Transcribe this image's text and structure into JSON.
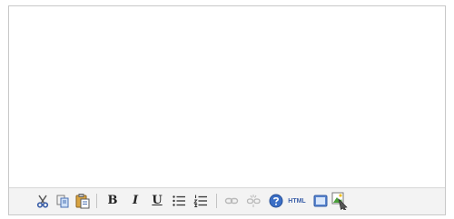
{
  "editor": {
    "content": ""
  },
  "toolbar": {
    "buttons": [
      {
        "icon": "cut-icon"
      },
      {
        "icon": "copy-icon"
      },
      {
        "icon": "paste-icon"
      },
      {
        "icon": "bold-icon",
        "label": "B"
      },
      {
        "icon": "italic-icon",
        "label": "I"
      },
      {
        "icon": "underline-icon",
        "label": "U"
      },
      {
        "icon": "bullet-list-icon"
      },
      {
        "icon": "numbered-list-icon"
      },
      {
        "icon": "link-icon"
      },
      {
        "icon": "unlink-icon"
      },
      {
        "icon": "help-icon"
      },
      {
        "icon": "html-source-icon",
        "label": "HTML"
      },
      {
        "icon": "fullscreen-icon"
      },
      {
        "icon": "insert-image-icon"
      }
    ]
  },
  "colors": {
    "toolbar_bg": "#f3f3f3",
    "border": "#c8c8c8",
    "icon_blue": "#3b5fa8",
    "disabled_gray": "#b8b8b8"
  }
}
